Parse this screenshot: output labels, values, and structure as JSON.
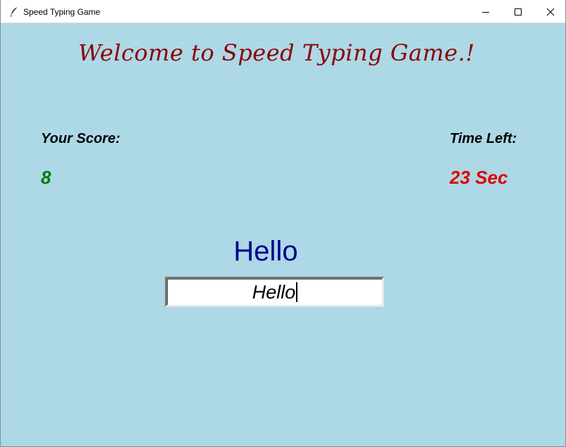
{
  "window": {
    "title": "Speed Typing Game",
    "icons": {
      "app": "feather-icon",
      "minimize": "minimize-icon",
      "maximize": "maximize-icon",
      "close": "close-icon"
    }
  },
  "game": {
    "welcome": "Welcome to Speed Typing Game.!",
    "score_label": "Your Score:",
    "score_value": "8",
    "time_label": "Time Left:",
    "time_value": "23",
    "time_unit": "Sec",
    "current_word": "Hello",
    "entry_value": "Hello"
  },
  "colors": {
    "background": "#add8e6",
    "welcome": "#8b0000",
    "score": "#008000",
    "time": "#e00000",
    "word": "#00008b"
  }
}
